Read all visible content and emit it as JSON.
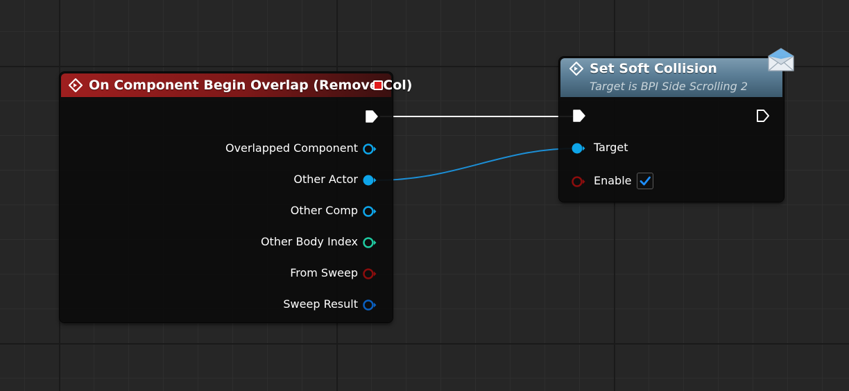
{
  "event_node": {
    "title": "On Component Begin Overlap (Remove Col)",
    "outputs": [
      {
        "label": "Overlapped Component",
        "pin_type": "object",
        "connected": false,
        "color": "#0ea5e9"
      },
      {
        "label": "Other Actor",
        "pin_type": "object",
        "connected": true,
        "color": "#0ea5e9"
      },
      {
        "label": "Other Comp",
        "pin_type": "object",
        "connected": false,
        "color": "#0ea5e9"
      },
      {
        "label": "Other Body Index",
        "pin_type": "integer",
        "connected": false,
        "color": "#1fc9a0"
      },
      {
        "label": "From Sweep",
        "pin_type": "boolean",
        "connected": false,
        "color": "#8c0d0d"
      },
      {
        "label": "Sweep Result",
        "pin_type": "struct",
        "connected": false,
        "color": "#0a5fbf"
      }
    ],
    "header_color": "#9e1f1f"
  },
  "function_node": {
    "title": "Set Soft Collision",
    "subtitle": "Target is BPI Side Scrolling 2",
    "inputs": [
      {
        "label": "Target",
        "pin_type": "object",
        "connected": true,
        "color": "#0ea5e9"
      },
      {
        "label": "Enable",
        "pin_type": "boolean",
        "connected": false,
        "color": "#8c0d0d",
        "checked": true
      }
    ],
    "header_color": "#5a7d95",
    "message_icon": "envelope-icon"
  },
  "colors": {
    "exec_wire": "#ffffff",
    "object_wire": "#1c8fd6",
    "checkmark": "#1e8fff"
  }
}
